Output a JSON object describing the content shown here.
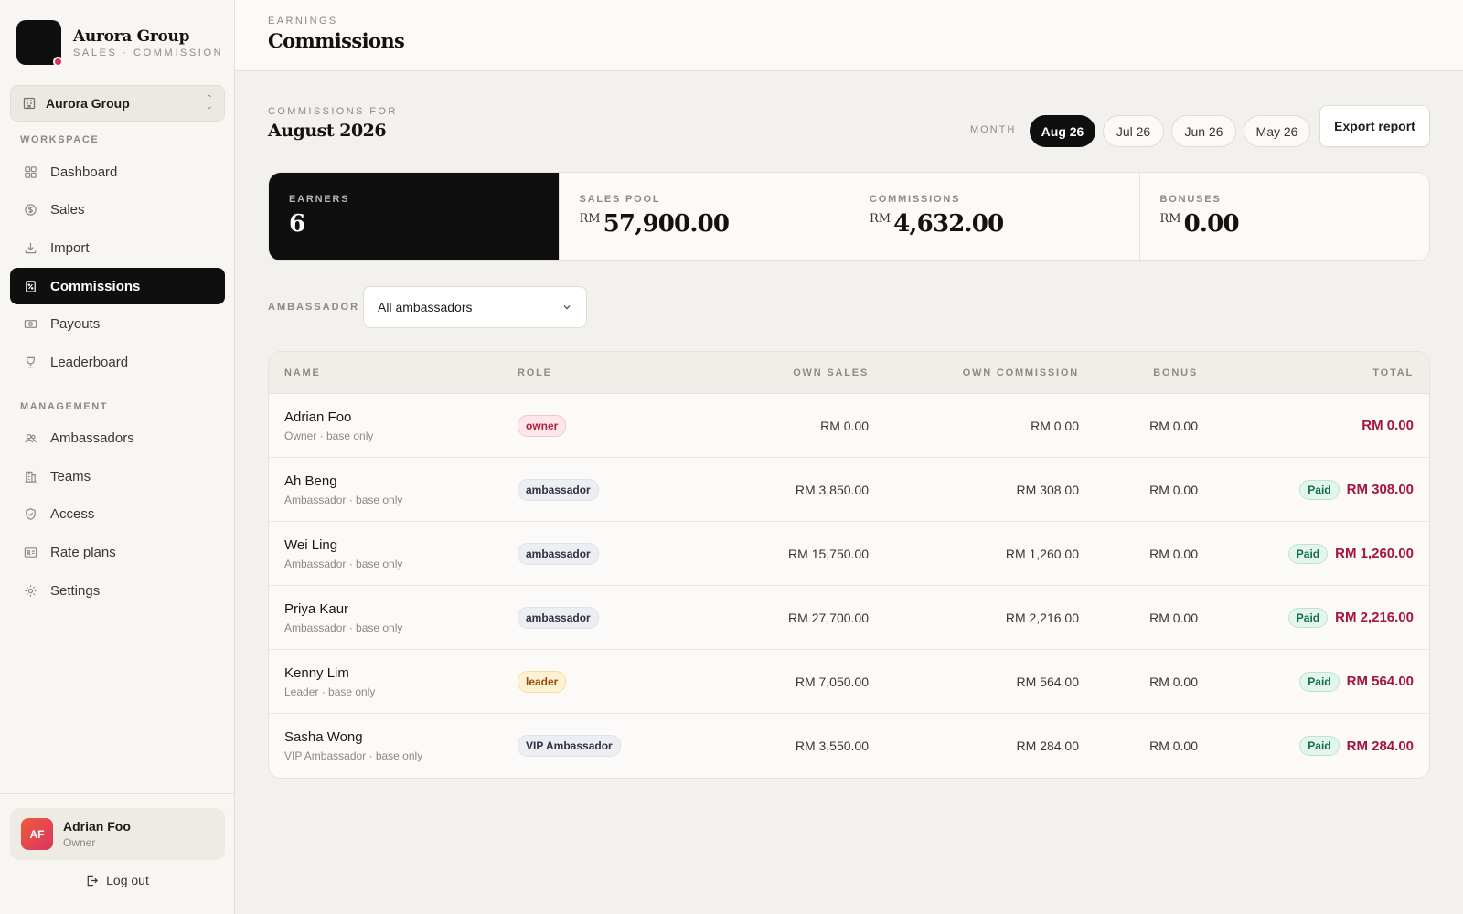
{
  "brand": {
    "name": "Aurora Group",
    "subtitle": "SALES · COMMISSION"
  },
  "org_switcher": {
    "label": "Aurora Group"
  },
  "sidebar": {
    "workspace_label": "WORKSPACE",
    "management_label": "MANAGEMENT",
    "workspace_items": [
      {
        "label": "Dashboard",
        "icon": "grid-icon"
      },
      {
        "label": "Sales",
        "icon": "dollar-icon"
      },
      {
        "label": "Import",
        "icon": "download-icon"
      },
      {
        "label": "Commissions",
        "icon": "percent-doc-icon",
        "active": true
      },
      {
        "label": "Payouts",
        "icon": "banknote-icon"
      },
      {
        "label": "Leaderboard",
        "icon": "trophy-icon"
      }
    ],
    "management_items": [
      {
        "label": "Ambassadors",
        "icon": "users-icon"
      },
      {
        "label": "Teams",
        "icon": "building-icon"
      },
      {
        "label": "Access",
        "icon": "shield-icon"
      },
      {
        "label": "Rate plans",
        "icon": "id-card-icon"
      },
      {
        "label": "Settings",
        "icon": "gear-icon"
      }
    ]
  },
  "user": {
    "initials": "AF",
    "name": "Adrian Foo",
    "role": "Owner",
    "logout_label": "Log out"
  },
  "header": {
    "eyebrow": "EARNINGS",
    "title": "Commissions"
  },
  "period": {
    "eyebrow": "COMMISSIONS FOR",
    "title": "August 2026"
  },
  "month_filter": {
    "label": "MONTH",
    "options": [
      "Aug 26",
      "Jul 26",
      "Jun 26",
      "May 26"
    ],
    "selected": "Aug 26"
  },
  "export_label": "Export report",
  "stats": {
    "earners": {
      "label": "EARNERS",
      "value": "6"
    },
    "sales_pool": {
      "label": "SALES POOL",
      "currency": "RM",
      "value": "57,900.00"
    },
    "commissions": {
      "label": "COMMISSIONS",
      "currency": "RM",
      "value": "4,632.00"
    },
    "bonuses": {
      "label": "BONUSES",
      "currency": "RM",
      "value": "0.00"
    }
  },
  "ambassador_filter": {
    "label": "AMBASSADOR",
    "value": "All ambassadors"
  },
  "table": {
    "columns": [
      "NAME",
      "ROLE",
      "OWN SALES",
      "OWN COMMISSION",
      "BONUS",
      "TOTAL"
    ],
    "rows": [
      {
        "name": "Adrian Foo",
        "sub": "Owner · base only",
        "role": "owner",
        "own_sales": "RM 0.00",
        "own_commission": "RM 0.00",
        "bonus": "RM 0.00",
        "status": "",
        "total": "RM 0.00"
      },
      {
        "name": "Ah Beng",
        "sub": "Ambassador · base only",
        "role": "ambassador",
        "own_sales": "RM 3,850.00",
        "own_commission": "RM 308.00",
        "bonus": "RM 0.00",
        "status": "Paid",
        "total": "RM 308.00"
      },
      {
        "name": "Wei Ling",
        "sub": "Ambassador · base only",
        "role": "ambassador",
        "own_sales": "RM 15,750.00",
        "own_commission": "RM 1,260.00",
        "bonus": "RM 0.00",
        "status": "Paid",
        "total": "RM 1,260.00"
      },
      {
        "name": "Priya Kaur",
        "sub": "Ambassador · base only",
        "role": "ambassador",
        "own_sales": "RM 27,700.00",
        "own_commission": "RM 2,216.00",
        "bonus": "RM 0.00",
        "status": "Paid",
        "total": "RM 2,216.00"
      },
      {
        "name": "Kenny Lim",
        "sub": "Leader · base only",
        "role": "leader",
        "own_sales": "RM 7,050.00",
        "own_commission": "RM 564.00",
        "bonus": "RM 0.00",
        "status": "Paid",
        "total": "RM 564.00"
      },
      {
        "name": "Sasha Wong",
        "sub": "VIP Ambassador · base only",
        "role": "VIP Ambassador",
        "own_sales": "RM 3,550.00",
        "own_commission": "RM 284.00",
        "bonus": "RM 0.00",
        "status": "Paid",
        "total": "RM 284.00"
      }
    ]
  },
  "colors": {
    "accent": "#0f0f0f",
    "total": "#a3163e",
    "paid": "#127046",
    "brand_dot": "#d9345f"
  }
}
